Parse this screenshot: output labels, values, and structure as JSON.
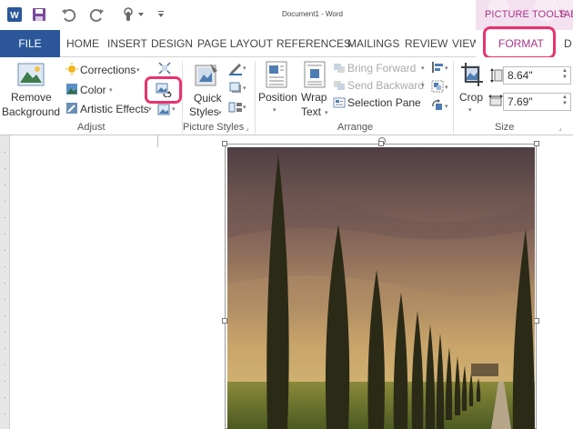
{
  "window": {
    "document_title": "Document1 - Word",
    "context_tools_label": "PICTURE TOOLS",
    "context_tools_extra": "TAB"
  },
  "tabs": {
    "file": "FILE",
    "home": "HOME",
    "insert": "INSERT",
    "design": "DESIGN",
    "page_layout": "PAGE LAYOUT",
    "references": "REFERENCES",
    "mailings": "MAILINGS",
    "review": "REVIEW",
    "view": "VIEW",
    "format": "FORMAT",
    "overflow": "D"
  },
  "ribbon": {
    "adjust": {
      "remove_background": "Remove Background",
      "corrections": "Corrections",
      "color": "Color",
      "artistic_effects": "Artistic Effects",
      "label": "Adjust"
    },
    "picture_styles": {
      "quick_styles": "Quick Styles",
      "label": "Picture Styles"
    },
    "arrange": {
      "position": "Position",
      "wrap_text": "Wrap Text",
      "bring_forward": "Bring Forward",
      "send_backward": "Send Backward",
      "selection_pane": "Selection Pane",
      "label": "Arrange"
    },
    "size": {
      "crop": "Crop",
      "height": "8.64\"",
      "width": "7.69\"",
      "label": "Size"
    }
  },
  "colors": {
    "file_tab": "#2b579a",
    "context_accent": "#a8358b",
    "highlight_ring": "#e8336e",
    "context_bg": "#f3e1ef"
  },
  "icons": [
    "save-icon",
    "undo-icon",
    "redo-icon",
    "touch-mode-icon",
    "customize-qat-icon",
    "compress-pictures-icon",
    "change-picture-icon",
    "reset-picture-icon",
    "picture-border-icon",
    "picture-effects-icon",
    "picture-layout-icon",
    "align-icon",
    "group-icon",
    "rotate-icon"
  ]
}
